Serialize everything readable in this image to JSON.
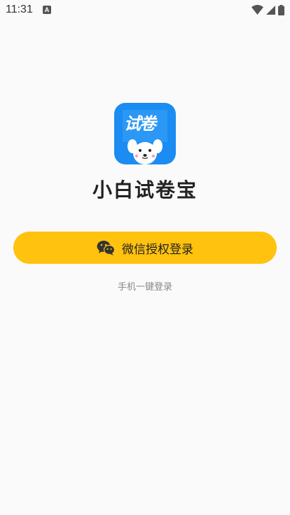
{
  "status_bar": {
    "time": "11:31",
    "notification_icon": "A",
    "icons": [
      "wifi-icon",
      "signal-icon",
      "battery-icon"
    ]
  },
  "app": {
    "logo_text": "试卷",
    "name": "小白试卷宝"
  },
  "login": {
    "wechat_label": "微信授权登录",
    "phone_label": "手机一键登录"
  },
  "colors": {
    "background": "#fafafa",
    "primary_button": "#ffc20e",
    "logo_blue": "#1a8cf2",
    "secondary_text": "#888888"
  }
}
